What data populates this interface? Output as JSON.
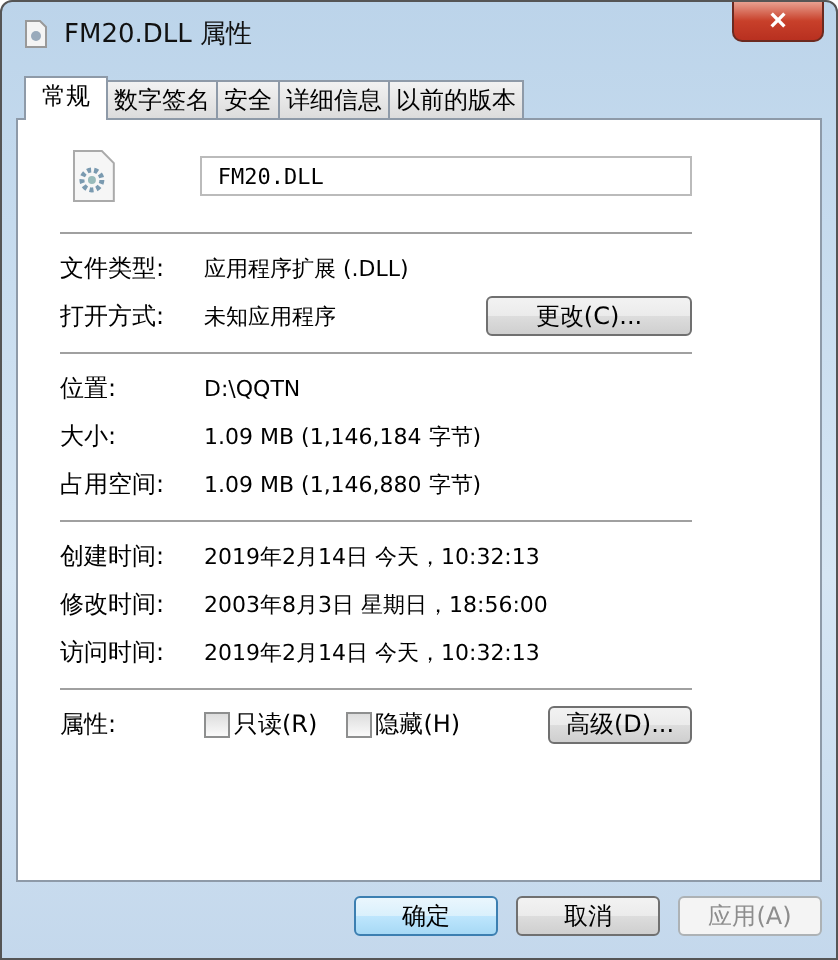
{
  "window": {
    "title": "FM20.DLL 属性",
    "close": "×"
  },
  "tabs": [
    {
      "label": "常规",
      "selected": true
    },
    {
      "label": "数字签名",
      "selected": false
    },
    {
      "label": "安全",
      "selected": false
    },
    {
      "label": "详细信息",
      "selected": false
    },
    {
      "label": "以前的版本",
      "selected": false
    }
  ],
  "file_name": "FM20.DLL",
  "sections": [
    [
      {
        "label": "文件类型:",
        "value": "应用程序扩展 (.DLL)"
      },
      {
        "label": "打开方式:",
        "value": "未知应用程序",
        "button": "更改(C)..."
      }
    ],
    [
      {
        "label": "位置:",
        "value": "D:\\QQTN"
      },
      {
        "label": "大小:",
        "value": "1.09 MB (1,146,184 字节)"
      },
      {
        "label": "占用空间:",
        "value": "1.09 MB (1,146,880 字节)"
      }
    ],
    [
      {
        "label": "创建时间:",
        "value": "2019年2月14日 今天，10:32:13"
      },
      {
        "label": "修改时间:",
        "value": "2003年8月3日 星期日，18:56:00"
      },
      {
        "label": "访问时间:",
        "value": "2019年2月14日 今天，10:32:13"
      }
    ]
  ],
  "attributes": {
    "label": "属性:",
    "checkboxes": [
      {
        "label": "只读(R)",
        "checked": false
      },
      {
        "label": "隐藏(H)",
        "checked": false
      }
    ],
    "button": "高级(D)..."
  },
  "buttons": [
    {
      "label": "确定",
      "default": true,
      "disabled": false
    },
    {
      "label": "取消",
      "default": false,
      "disabled": false
    },
    {
      "label": "应用(A)",
      "default": false,
      "disabled": true
    }
  ]
}
